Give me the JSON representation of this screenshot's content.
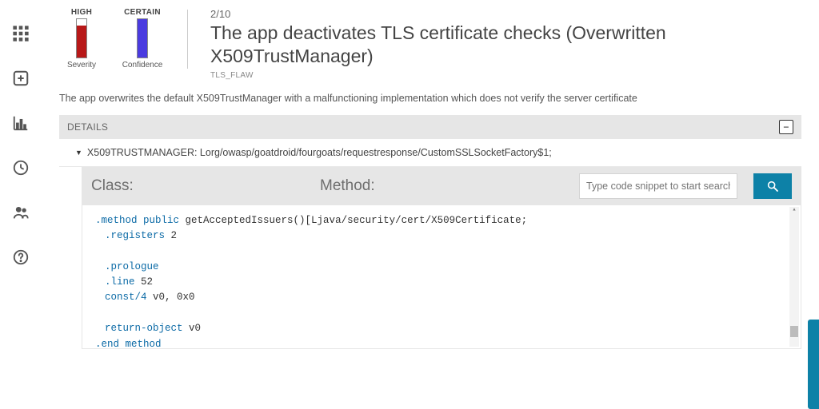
{
  "rail": {
    "items": [
      {
        "name": "grid-icon"
      },
      {
        "name": "plus-box-icon"
      },
      {
        "name": "bar-chart-icon"
      },
      {
        "name": "clock-icon"
      },
      {
        "name": "users-icon"
      },
      {
        "name": "help-icon"
      }
    ]
  },
  "finding": {
    "severity": {
      "label_top": "HIGH",
      "label_bottom": "Severity",
      "fill_ratio": 0.84,
      "color": "#b81818"
    },
    "confidence": {
      "label_top": "CERTAIN",
      "label_bottom": "Confidence",
      "fill_ratio": 1.0,
      "color": "#4a3be0"
    },
    "index": "2/10",
    "title": "The app deactivates TLS certificate checks (Overwritten X509TrustManager)",
    "flaw_tag": "TLS_FLAW",
    "description": "The app overwrites the default X509TrustManager with a malfunctioning implementation which does not verify the server certificate"
  },
  "details": {
    "header": "DETAILS",
    "collapse_symbol": "−",
    "tree_item": "X509TRUSTMANAGER: Lorg/owasp/goatdroid/fourgoats/requestresponse/CustomSSLSocketFactory$1;"
  },
  "code_head": {
    "class_label": "Class:",
    "method_label": "Method:",
    "search_placeholder": "Type code snippet to start search"
  },
  "code": {
    "l1_kw": ".method public",
    "l1_rest": " getAcceptedIssuers()[Ljava/security/cert/X509Certificate;",
    "l2_kw": ".registers",
    "l2_rest": " 2",
    "l3_kw": ".prologue",
    "l4_kw": ".line",
    "l4_rest": " 52",
    "l5_kw": "const/4",
    "l5_rest": " v0, 0x0",
    "l6_kw": "return-object",
    "l6_rest": " v0",
    "l7_kw": ".end method"
  }
}
